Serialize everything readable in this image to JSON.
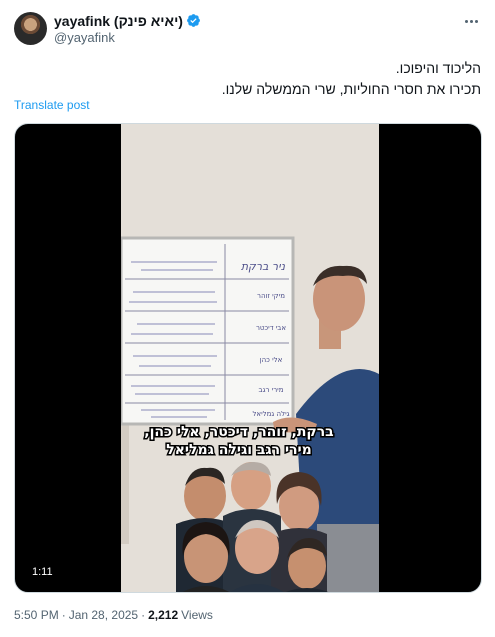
{
  "author": {
    "display_name": "yayafink (יאיא פינק)",
    "handle": "@yayafink",
    "avatar_icon": "user-avatar"
  },
  "post": {
    "line1": "הליכוד והיפוכו.",
    "line2": "תכירו את חסרי החוליות, שרי הממשלה שלנו.",
    "translate_label": "Translate post"
  },
  "video": {
    "duration": "1:11",
    "subtitle_line1": "ברקת, זוהר, דיכטר, אלי כהן,",
    "subtitle_line2": "מירי רגב וגילה גמליאל",
    "board_header_left": "ניר ברקת",
    "board_names": [
      "מיקי זוהר",
      "אבי דיכטר",
      "אלי כהן",
      "מירי רגב",
      "גילה גמליאל"
    ]
  },
  "meta": {
    "time": "5:50 PM",
    "separator": "·",
    "date": "Jan 28, 2025",
    "views_count": "2,212",
    "views_label": "Views"
  },
  "colors": {
    "text": "#0f1419",
    "secondary": "#536471",
    "link": "#1d9bf0",
    "verified": "#1d9bf0"
  }
}
